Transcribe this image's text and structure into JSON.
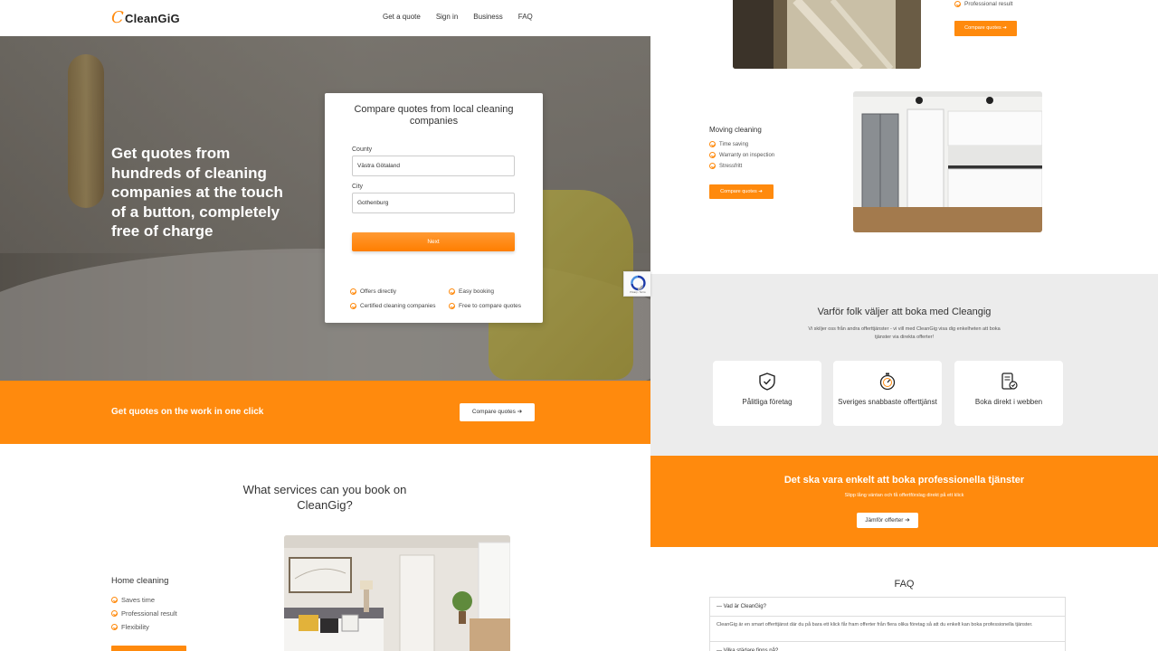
{
  "nav": {
    "logo_mark": "C",
    "logo_text": "CleanGiG",
    "links": [
      "Get a quote",
      "Sign in",
      "Business",
      "FAQ"
    ]
  },
  "hero": {
    "title": "Get quotes from hundreds of cleaning companies at the touch of a button, completely free of charge"
  },
  "quote_form": {
    "title": "Compare quotes from local cleaning companies",
    "county_label": "County",
    "county_value": "Västra Götaland",
    "city_label": "City",
    "city_value": "Gothenburg",
    "next_label": "Next",
    "features": [
      "Offers directly",
      "Easy booking",
      "Certified cleaning companies",
      "Free to compare quotes"
    ]
  },
  "cta_band": {
    "text": "Get quotes on the work in one click",
    "button": "Compare quotes ➔"
  },
  "services": {
    "title": "What services can you book on CleanGig?",
    "home": {
      "title": "Home cleaning",
      "items": [
        "Saves time",
        "Professional result",
        "Flexibility"
      ]
    },
    "window": {
      "items": [
        "Professional result"
      ],
      "button": "Compare quotes ➔"
    },
    "moving": {
      "title": "Moving cleaning",
      "items": [
        "Time saving",
        "Warranty on inspection",
        "Stressfritt"
      ],
      "button": "Compare quotes ➔"
    }
  },
  "why": {
    "title": "Varför folk väljer att boka med Cleangig",
    "subtitle": "Vi skiljer oss från andra offerttjänster - vi vill med CleanGig visa dig enkelheten att boka tjänster via direkta offerter!",
    "cards": [
      "Pålitliga företag",
      "Sveriges snabbaste offerttjänst",
      "Boka direkt i webben"
    ]
  },
  "cta_band2": {
    "title": "Det ska vara enkelt att boka professionella tjänster",
    "subtitle": "Slipp lång väntan och få offertförslag direkt på ett klick",
    "button": "Jämför offerter ➔"
  },
  "faq": {
    "title": "FAQ",
    "q1": "— Vad är CleanGig?",
    "a1": "CleanGig är en smart offerttjänst där du på bara ett klick får fram offerter från flera olika företag så att du enkelt kan boka professionella tjänster.",
    "q2": "— Vilka städare finns på?"
  },
  "recaptcha": {
    "text": "Privacy - Terms"
  },
  "colors": {
    "accent": "#ff8a0d"
  }
}
